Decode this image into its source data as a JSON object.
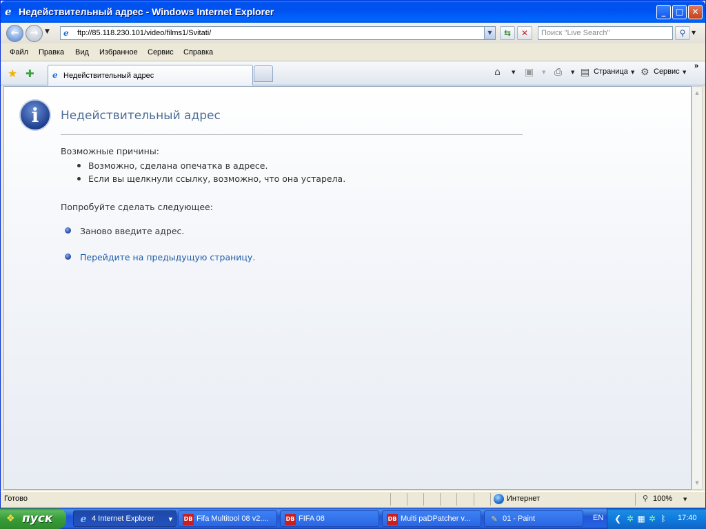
{
  "window": {
    "title": "Недействительный адрес - Windows Internet Explorer",
    "min_glyph": "_",
    "max_glyph": "□",
    "close_glyph": "✕"
  },
  "address": {
    "url": "ftp://85.118.230.101/video/films1/Svitati/",
    "search_placeholder": "Поиск \"Live Search\""
  },
  "menu": {
    "items": [
      "Файл",
      "Правка",
      "Вид",
      "Избранное",
      "Сервис",
      "Справка"
    ]
  },
  "cmdbar": {
    "tab_label": "Недействительный адрес",
    "page_label": "Страница",
    "tools_label": "Сервис",
    "chevron": "»"
  },
  "content": {
    "title": "Недействительный адрес",
    "reasons_heading": "Возможные причины:",
    "reasons": [
      "Возможно, сделана опечатка в адресе.",
      "Если вы щелкнули ссылку, возможно, что она устарела."
    ],
    "try_heading": "Попробуйте сделать следующее:",
    "actions": [
      "Заново введите адрес.",
      "Перейдите на предыдущую страницу."
    ]
  },
  "status": {
    "text": "Готово",
    "zone": "Интернет",
    "zoom": "100%"
  },
  "taskbar": {
    "start_label": "пуск",
    "tasks": [
      "4 Internet Explorer",
      "Fifa Multitool 08 v2....",
      "FIFA 08",
      "Multi paDPatcher v...",
      "01 - Paint"
    ],
    "lang": "EN",
    "clock": "17:40"
  },
  "colors": {
    "title_bar": "#0053ee",
    "link": "#1e5ba8",
    "heading": "#4d6d95",
    "start": "#379e37"
  }
}
